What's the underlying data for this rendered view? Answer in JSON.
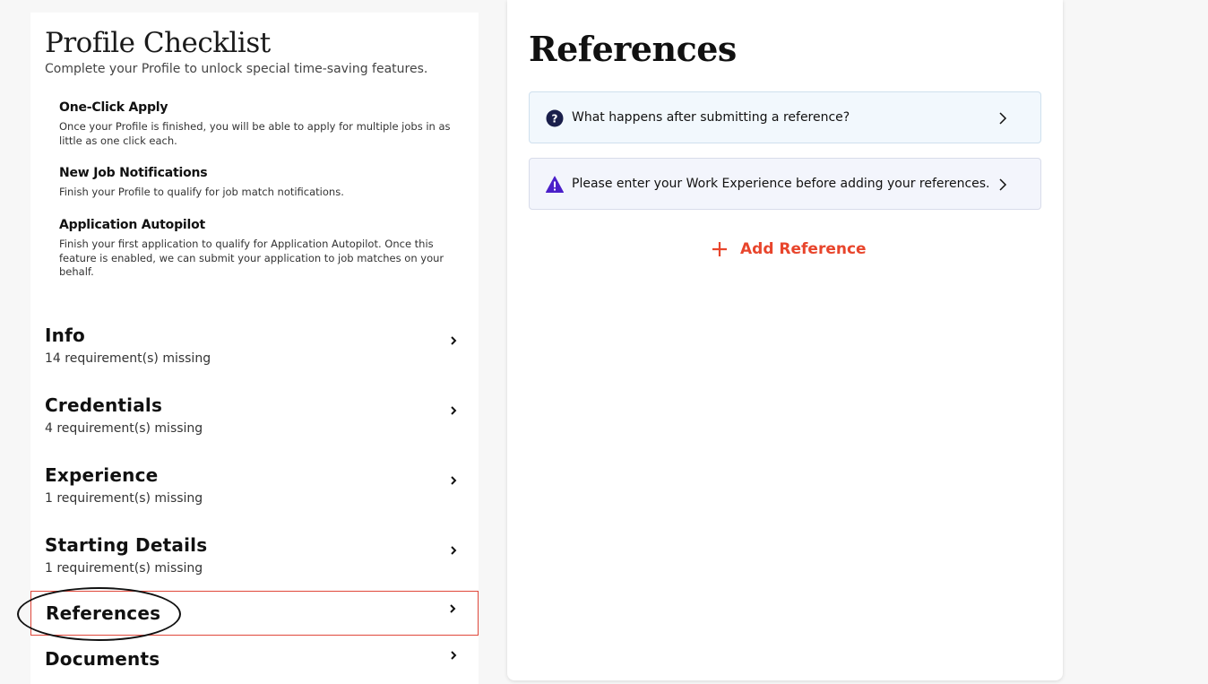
{
  "checklist": {
    "title": "Profile Checklist",
    "subtitle": "Complete your Profile to unlock special time-saving features.",
    "features": [
      {
        "title": "One-Click Apply",
        "desc": "Once your Profile is finished, you will be able to apply for multiple jobs in as little as one click each."
      },
      {
        "title": "New Job Notifications",
        "desc": "Finish your Profile to qualify for job match notifications."
      },
      {
        "title": "Application Autopilot",
        "desc": "Finish your first application to qualify for Application Autopilot. Once this feature is enabled, we can submit your application to job matches on your behalf."
      }
    ],
    "sections": [
      {
        "name": "Info",
        "missing": "14 requirement(s) missing"
      },
      {
        "name": "Credentials",
        "missing": "4 requirement(s) missing"
      },
      {
        "name": "Experience",
        "missing": "1 requirement(s) missing"
      },
      {
        "name": "Starting Details",
        "missing": "1 requirement(s) missing"
      },
      {
        "name": "References"
      },
      {
        "name": "Documents"
      }
    ]
  },
  "references": {
    "title": "References",
    "cards": [
      {
        "text": "What happens after submitting a reference?",
        "icon": "question-icon"
      },
      {
        "text": "Please enter your Work Experience before adding your references.",
        "icon": "warning-icon"
      }
    ],
    "add_label": "Add Reference"
  },
  "colors": {
    "accent": "#e8452c",
    "icon_navy": "#1a1f4b",
    "warning_purple": "#4b1fc9"
  }
}
